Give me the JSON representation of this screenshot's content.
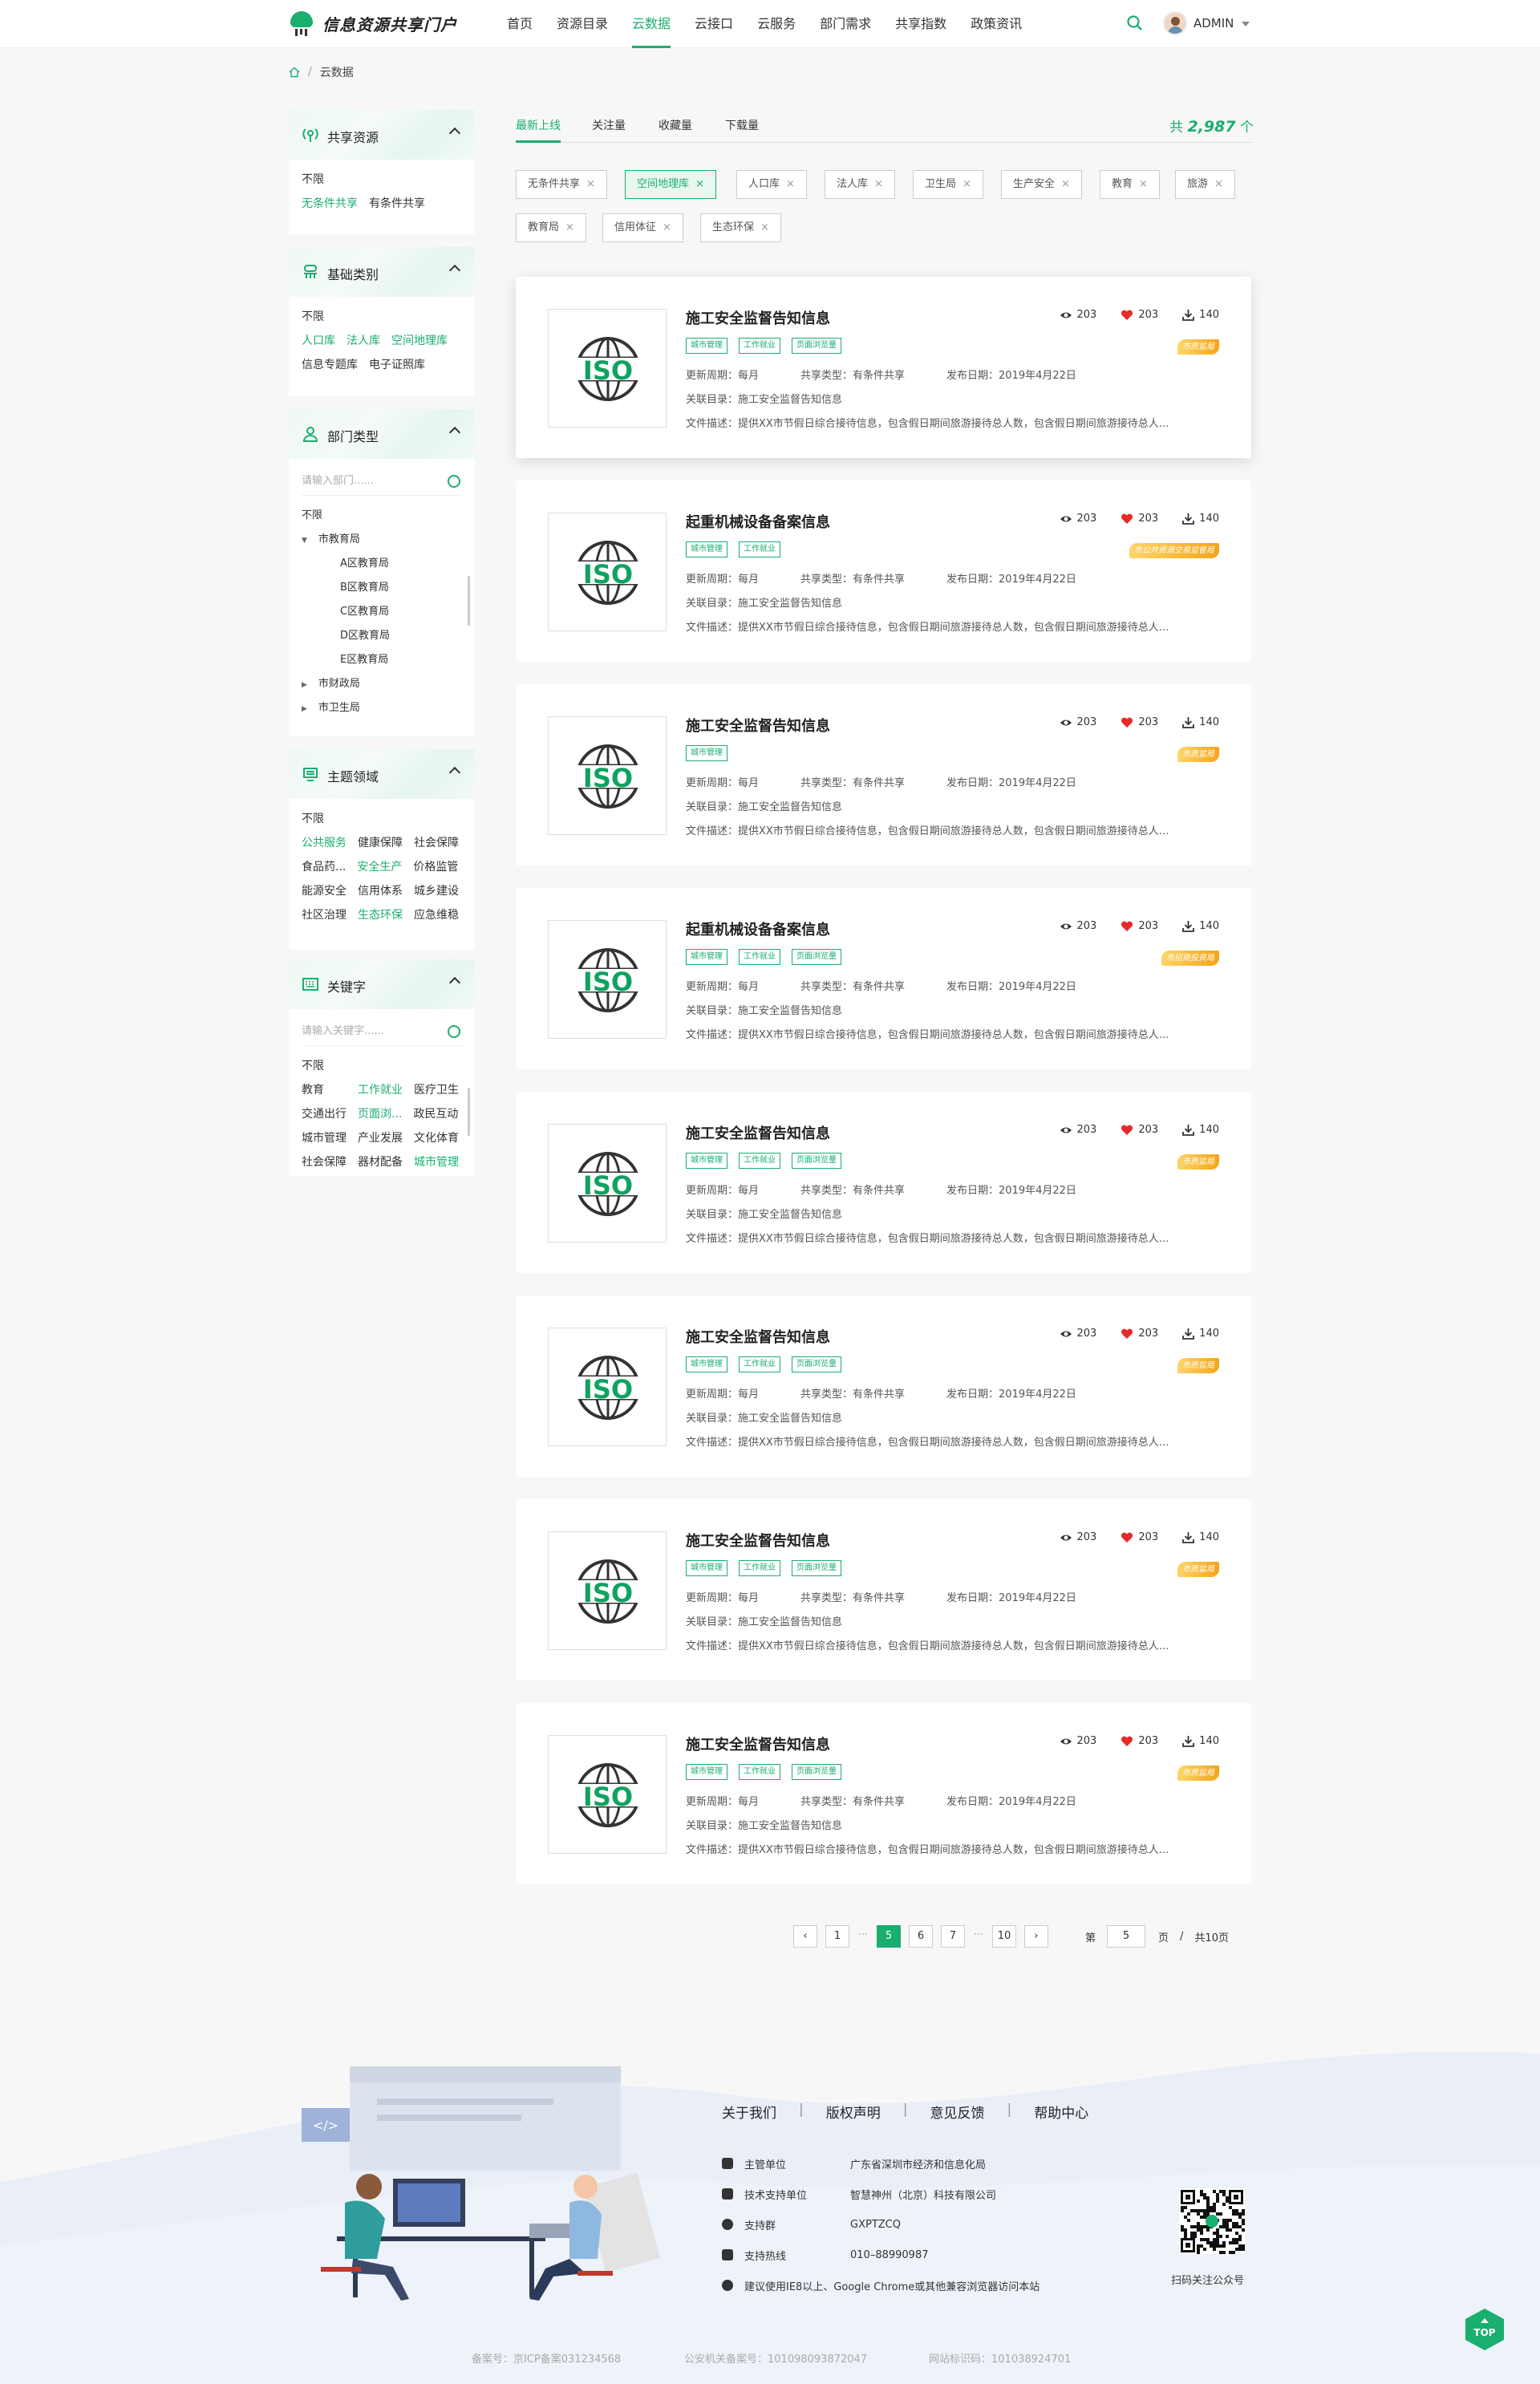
{
  "header": {
    "logo_text": "信息资源共享门户",
    "nav": [
      "首页",
      "资源目录",
      "云数据",
      "云接口",
      "云服务",
      "部门需求",
      "共享指数",
      "政策资讯"
    ],
    "active_nav": 2,
    "user": "ADMIN"
  },
  "breadcrumb": {
    "current": "云数据",
    "separator": "/"
  },
  "sidebar": {
    "share": {
      "title": "共享资源",
      "options": [
        "不限",
        "无条件共享",
        "有条件共享"
      ]
    },
    "basic": {
      "title": "基础类别",
      "rows": [
        [
          "不限"
        ],
        [
          "人口库",
          "法人库",
          "空间地理库"
        ],
        [
          "信息专题库",
          "电子证照库"
        ]
      ]
    },
    "dept": {
      "title": "部门类型",
      "placeholder": "请输入部门......",
      "items": [
        "不限",
        "市教育局",
        "A区教育局",
        "B区教育局",
        "C区教育局",
        "D区教育局",
        "E区教育局",
        "市财政局",
        "市卫生局"
      ]
    },
    "theme": {
      "title": "主题领域",
      "rows": [
        [
          "不限"
        ],
        [
          "公共服务",
          "健康保障",
          "社会保障"
        ],
        [
          "食品药...",
          "安全生产",
          "价格监管"
        ],
        [
          "能源安全",
          "信用体系",
          "城乡建设"
        ],
        [
          "社区治理",
          "生态环保",
          "应急维稳"
        ]
      ]
    },
    "keyword": {
      "title": "关键字",
      "placeholder": "请输入关键字......",
      "rows": [
        [
          "不限"
        ],
        [
          "教育",
          "工作就业",
          "医疗卫生"
        ],
        [
          "交通出行",
          "页面浏...",
          "政民互动"
        ],
        [
          "城市管理",
          "产业发展",
          "文化体育"
        ],
        [
          "社会保障",
          "器材配备",
          "城市管理"
        ]
      ]
    }
  },
  "tabs": [
    "最新上线",
    "关注量",
    "收藏量",
    "下载量"
  ],
  "total": {
    "prefix": "共",
    "value": "2,987",
    "suffix": "个"
  },
  "filters": [
    "无条件共享",
    "空间地理库",
    "人口库",
    "法人库",
    "卫生局",
    "生产安全",
    "教育",
    "旅游",
    "教育局",
    "信用体征",
    "生态环保"
  ],
  "filter_close": "×",
  "iso_label": "ISO",
  "cards": [
    {
      "title": "施工安全监督告知信息",
      "tags": [
        "城市管理",
        "工作就业",
        "页面浏览量"
      ],
      "badge": "市质监局",
      "views": "203",
      "likes": "203",
      "downloads": "140",
      "cycle": "更新周期：每月",
      "share_type": "共享类型：有条件共享",
      "date": "发布日期：2019年4月22日",
      "catalog": "关联目录：施工安全监督告知信息",
      "desc": "文件描述：提供XX市节假日综合接待信息，包含假日期间旅游接待总人数，包含假日期间旅游接待总人..."
    },
    {
      "title": "起重机械设备备案信息",
      "tags": [
        "城市管理",
        "工作就业"
      ],
      "badge": "市公共资源交易监督局",
      "views": "203",
      "likes": "203",
      "downloads": "140",
      "cycle": "更新周期：每月",
      "share_type": "共享类型：有条件共享",
      "date": "发布日期：2019年4月22日",
      "catalog": "关联目录：施工安全监督告知信息",
      "desc": "文件描述：提供XX市节假日综合接待信息，包含假日期间旅游接待总人数，包含假日期间旅游接待总人..."
    },
    {
      "title": "施工安全监督告知信息",
      "tags": [
        "城市管理"
      ],
      "badge": "市质监局",
      "views": "203",
      "likes": "203",
      "downloads": "140",
      "cycle": "更新周期：每月",
      "share_type": "共享类型：有条件共享",
      "date": "发布日期：2019年4月22日",
      "catalog": "关联目录：施工安全监督告知信息",
      "desc": "文件描述：提供XX市节假日综合接待信息，包含假日期间旅游接待总人数，包含假日期间旅游接待总人..."
    },
    {
      "title": "起重机械设备备案信息",
      "tags": [
        "城市管理",
        "工作就业",
        "页面浏览量"
      ],
      "badge": "市招商投资局",
      "views": "203",
      "likes": "203",
      "downloads": "140",
      "cycle": "更新周期：每月",
      "share_type": "共享类型：有条件共享",
      "date": "发布日期：2019年4月22日",
      "catalog": "关联目录：施工安全监督告知信息",
      "desc": "文件描述：提供XX市节假日综合接待信息，包含假日期间旅游接待总人数，包含假日期间旅游接待总人..."
    },
    {
      "title": "施工安全监督告知信息",
      "tags": [
        "城市管理",
        "工作就业",
        "页面浏览量"
      ],
      "badge": "市质监局",
      "views": "203",
      "likes": "203",
      "downloads": "140",
      "cycle": "更新周期：每月",
      "share_type": "共享类型：有条件共享",
      "date": "发布日期：2019年4月22日",
      "catalog": "关联目录：施工安全监督告知信息",
      "desc": "文件描述：提供XX市节假日综合接待信息，包含假日期间旅游接待总人数，包含假日期间旅游接待总人..."
    },
    {
      "title": "施工安全监督告知信息",
      "tags": [
        "城市管理",
        "工作就业",
        "页面浏览量"
      ],
      "badge": "市质监局",
      "views": "203",
      "likes": "203",
      "downloads": "140",
      "cycle": "更新周期：每月",
      "share_type": "共享类型：有条件共享",
      "date": "发布日期：2019年4月22日",
      "catalog": "关联目录：施工安全监督告知信息",
      "desc": "文件描述：提供XX市节假日综合接待信息，包含假日期间旅游接待总人数，包含假日期间旅游接待总人..."
    },
    {
      "title": "施工安全监督告知信息",
      "tags": [
        "城市管理",
        "工作就业",
        "页面浏览量"
      ],
      "badge": "市质监局",
      "views": "203",
      "likes": "203",
      "downloads": "140",
      "cycle": "更新周期：每月",
      "share_type": "共享类型：有条件共享",
      "date": "发布日期：2019年4月22日",
      "catalog": "关联目录：施工安全监督告知信息",
      "desc": "文件描述：提供XX市节假日综合接待信息，包含假日期间旅游接待总人数，包含假日期间旅游接待总人..."
    },
    {
      "title": "施工安全监督告知信息",
      "tags": [
        "城市管理",
        "工作就业",
        "页面浏览量"
      ],
      "badge": "市质监局",
      "views": "203",
      "likes": "203",
      "downloads": "140",
      "cycle": "更新周期：每月",
      "share_type": "共享类型：有条件共享",
      "date": "发布日期：2019年4月22日",
      "catalog": "关联目录：施工安全监督告知信息",
      "desc": "文件描述：提供XX市节假日综合接待信息，包含假日期间旅游接待总人数，包含假日期间旅游接待总人..."
    }
  ],
  "pagination": {
    "pages": [
      "1",
      "···",
      "5",
      "6",
      "7",
      "···",
      "10"
    ],
    "active": "5",
    "page_label": "第",
    "page_value": "5",
    "page_unit": "页",
    "divider": "/",
    "total_pages": "共10页"
  },
  "footer": {
    "links": [
      "关于我们",
      "版权声明",
      "意见反馈",
      "帮助中心"
    ],
    "link_separator": "|",
    "info": [
      {
        "k": "主管单位",
        "v": "广东省深圳市经济和信息化局"
      },
      {
        "k": "技术支持单位",
        "v": "智慧神州（北京）科技有限公司"
      },
      {
        "k": "支持群",
        "v": "GXPTZCQ"
      },
      {
        "k": "支持热线",
        "v": "010–88990987"
      }
    ],
    "notice": "建议使用IE8以上、Google Chrome或其他兼容浏览器访问本站",
    "qr_caption": "扫码关注公众号",
    "code_glyph": "</>",
    "beian": [
      "备案号：京ICP备案031234568",
      "公安机关备案号：101098093872047",
      "网站标识码：101038924701"
    ],
    "top_label": "TOP"
  },
  "colors": {
    "accent": "#1aae6f",
    "badge": "#f4a418"
  }
}
